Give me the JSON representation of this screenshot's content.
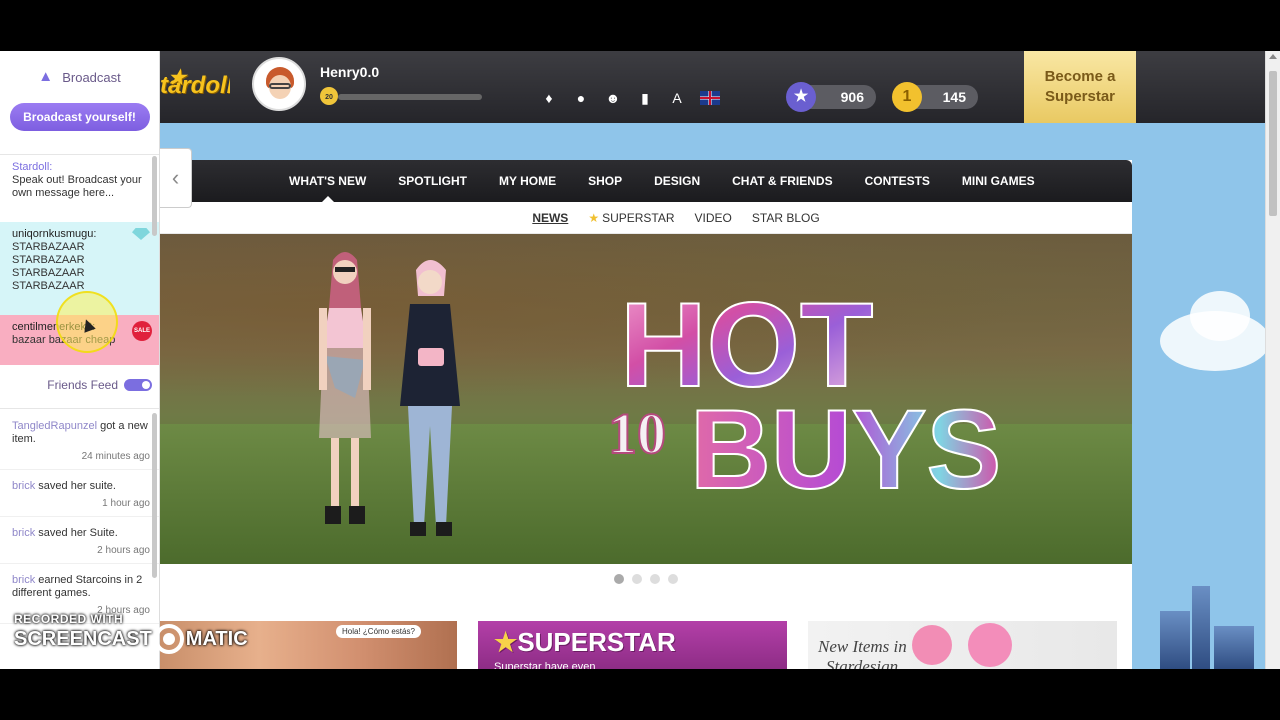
{
  "sidebar": {
    "broadcast_title": "Broadcast",
    "broadcast_button": "Broadcast yourself!",
    "broadcasts": [
      {
        "user": "Stardoll",
        "sep": ":",
        "text": "Speak out! Broadcast your own message here..."
      },
      {
        "user": "uniqornkusmugu",
        "sep": ":",
        "text": "STARBAZAAR STARBAZAAR STARBAZAAR STARBAZAAR"
      },
      {
        "user": "centilmenerkek8",
        "sep": ":",
        "text": "bazaar bazaar cheap",
        "badge": "SALE"
      }
    ],
    "friends_feed_title": "Friends Feed",
    "feed": [
      {
        "user": "TangledRapunzel",
        "action": " got a new item.",
        "time": "24 minutes ago"
      },
      {
        "user": "brick",
        "action": " saved her suite.",
        "time": "1 hour ago"
      },
      {
        "user": "brick",
        "action": " saved her Suite.",
        "time": "2 hours ago"
      },
      {
        "user": "brick",
        "action": " earned Starcoins in 2 different games.",
        "time": "2 hours ago"
      }
    ]
  },
  "header": {
    "logo_text": "tardoll",
    "username": "Henry0.0",
    "level": "20",
    "stardollars": "906",
    "starcoins": "145",
    "superstar_button": "Become a Superstar",
    "icons": [
      "bell-icon",
      "chat-icon",
      "friends-icon",
      "bookmark-icon",
      "font-icon",
      "uk-flag-icon"
    ]
  },
  "nav": {
    "items": [
      "WHAT'S NEW",
      "SPOTLIGHT",
      "MY HOME",
      "SHOP",
      "DESIGN",
      "CHAT & FRIENDS",
      "CONTESTS",
      "MINI GAMES"
    ],
    "active_index": 0
  },
  "subnav": {
    "items": [
      "NEWS",
      "SUPERSTAR",
      "VIDEO",
      "STAR BLOG"
    ],
    "selected_index": 0
  },
  "banner": {
    "line1": "HOT",
    "line2_num": "10",
    "line2": "BUYS"
  },
  "carousel": {
    "count": 4,
    "active": 0
  },
  "promos": [
    {
      "bubble": "Hola! ¿Cómo estás?"
    },
    {
      "title": "SUPERSTAR",
      "sub": "Superstar have even"
    },
    {
      "title": "New Items in",
      "sub": "Stardesign"
    }
  ],
  "watermark": {
    "line1": "RECORDED WITH",
    "line2_a": "SCREENCAST",
    "line2_b": "MATIC"
  },
  "colors": {
    "accent": "#7b6ee0",
    "gold": "#e9c962",
    "dark": "#25252a"
  }
}
